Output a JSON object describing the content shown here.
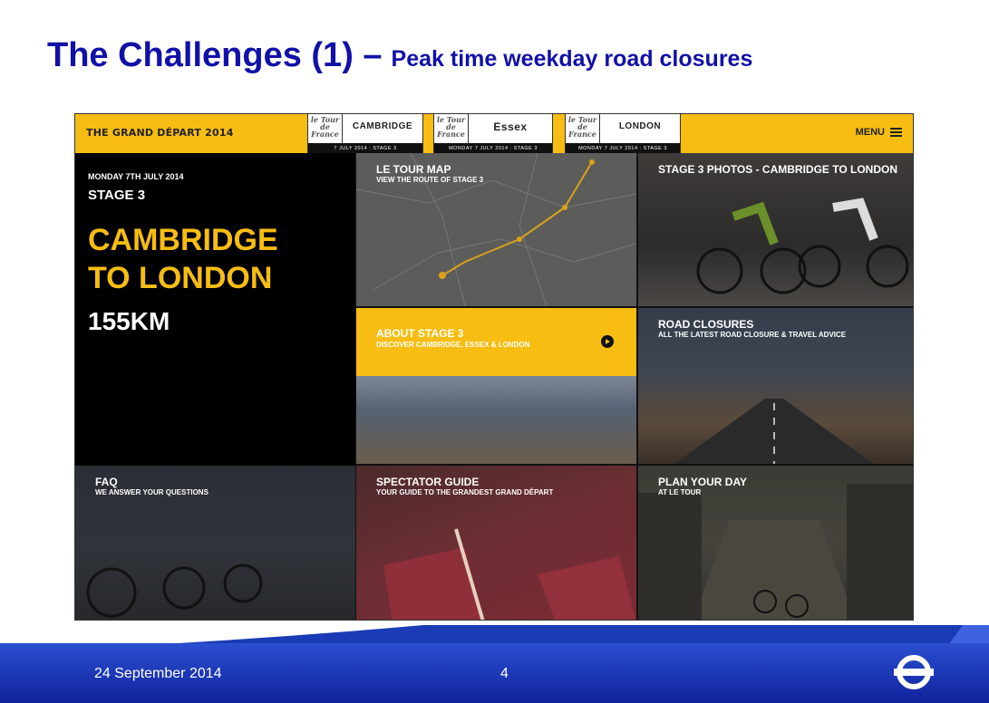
{
  "slide": {
    "title": "The Challenges (1) –",
    "subtitle": "Peak time weekday road closures",
    "footer_date": "24 September 2014",
    "page_number": "4"
  },
  "site": {
    "brand": "THE GRAND DÉPART 2014",
    "menu_label": "MENU",
    "logos": [
      {
        "tdf": "le Tour de France",
        "name": "CAMBRIDGE",
        "date": "7 JULY 2014 : STAGE 3"
      },
      {
        "tdf": "le Tour de France",
        "name": "Essex",
        "date": "MONDAY 7 JULY 2014 : STAGE 3"
      },
      {
        "tdf": "le Tour de France",
        "name": "LONDON",
        "date": "MONDAY 7 JULY 2014 : STAGE 3"
      }
    ],
    "stage_panel": {
      "date": "MONDAY 7TH JULY 2014",
      "stage": "STAGE 3",
      "route": "CAMBRIDGE TO LONDON",
      "distance": "155KM"
    },
    "tiles": {
      "map": {
        "title": "LE TOUR MAP",
        "subtitle": "VIEW THE ROUTE OF STAGE 3"
      },
      "photos": {
        "title": "STAGE 3 PHOTOS - CAMBRIDGE TO LONDON"
      },
      "about": {
        "title": "ABOUT STAGE 3",
        "subtitle": "DISCOVER CAMBRIDGE, ESSEX & LONDON"
      },
      "road": {
        "title": "ROAD CLOSURES",
        "subtitle": "ALL THE LATEST ROAD CLOSURE & TRAVEL ADVICE"
      },
      "faq": {
        "title": "FAQ",
        "subtitle": "WE ANSWER YOUR QUESTIONS"
      },
      "spectator": {
        "title": "SPECTATOR GUIDE",
        "subtitle": "YOUR GUIDE TO THE GRANDEST GRAND DÉPART"
      },
      "plan": {
        "title": "PLAN YOUR DAY",
        "subtitle": "AT LE TOUR"
      }
    }
  },
  "colors": {
    "title_blue": "#1111a8",
    "accent_yellow": "#f8bd12",
    "footer_blue": "#10239c",
    "roundel_blue": "#10239c"
  },
  "icons": [
    "hamburger-menu-icon",
    "arrow-right-icon",
    "tfl-roundel-icon"
  ]
}
